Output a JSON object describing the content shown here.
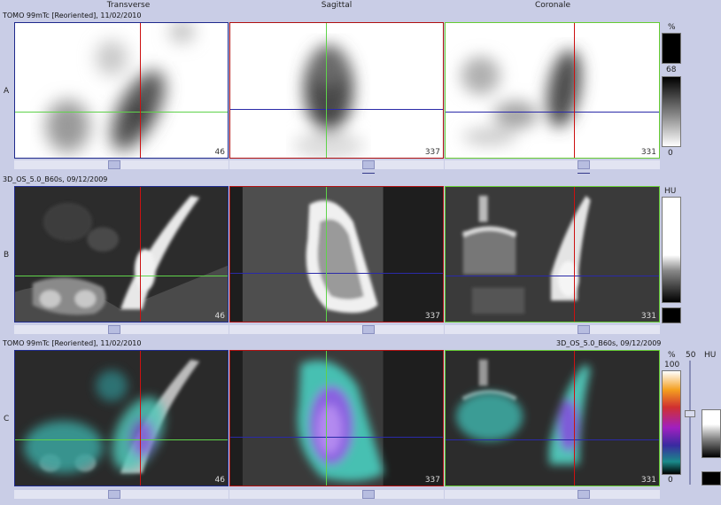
{
  "columns": [
    "Transverse",
    "Sagittal",
    "Coronale"
  ],
  "rows": [
    {
      "letter": "A",
      "header": "TOMO 99mTc [Reoriented], 11/02/2010"
    },
    {
      "letter": "B",
      "header": "3D_OS_5.0_B60s, 09/12/2009"
    },
    {
      "letter": "C",
      "header": "TOMO 99mTc [Reoriented], 11/02/2010",
      "header_right": "3D_OS_5.0_B60s, 09/12/2009"
    }
  ],
  "slices": {
    "transverse": "46",
    "sagittal": "337",
    "coronale": "331"
  },
  "scales": {
    "a": {
      "unit": "%",
      "max": "68",
      "min": "0"
    },
    "b": {
      "unit": "HU"
    },
    "c": {
      "unit": "%",
      "max": "100",
      "min": "0",
      "fusion_value": "50",
      "ct_unit": "HU"
    }
  },
  "colors": {
    "background": "#c9cde6",
    "crosshair_red": "#cc1111",
    "crosshair_green": "#5fd34a",
    "crosshair_blue": "#2a2aa8",
    "frame_transverse": "#1f2a8c",
    "frame_sagittal": "#b01010",
    "frame_coronale": "#66cc33"
  }
}
